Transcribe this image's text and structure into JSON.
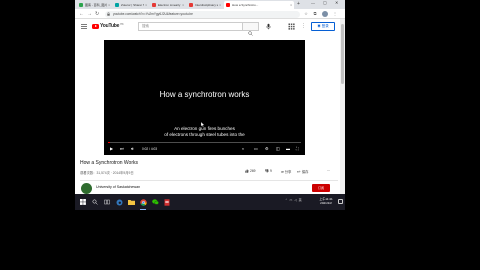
{
  "browser": {
    "tabs": [
      {
        "label": "图客 - 百科_图片...",
        "color": "#2da44e",
        "active": false
      },
      {
        "label": "Zoteror | Sharer N...",
        "color": "#00a3a3",
        "active": false
      },
      {
        "label": "Electron Linearly ...",
        "color": "#e53935",
        "active": false
      },
      {
        "label": "Interdisciplinary s...",
        "color": "#e53935",
        "active": false
      },
      {
        "label": "How a Synchrotro...",
        "color": "#ff0000",
        "active": true
      }
    ],
    "new_tab": "+",
    "url": "youtube.com/watch?v=Yu2mYgy6J2U&feature=youtu.be"
  },
  "youtube": {
    "logo_word": "YouTube",
    "region": "HK",
    "search_placeholder": "搜索",
    "sign_in": "登录"
  },
  "player": {
    "title": "How a synchrotron works",
    "caption_line1": "An electron gun fires bunches",
    "caption_line2": "of electrons through steel tubes into the",
    "time": "0:02 / 4:03",
    "progress": 0.008
  },
  "video": {
    "title": "How a Synchrotron Works",
    "views_date": "观看次数：31,574次 · 2014年9月9日",
    "likes": "269",
    "dislikes": "9",
    "share": "分享",
    "save": "保存",
    "channel": "University of Saskatchewan",
    "subscribe": "订阅"
  },
  "taskbar": {
    "clock_time": "上午11:41",
    "clock_date": "2021/1/2",
    "ime": "英",
    "colors": {
      "chrome": "#4285f4",
      "accent": "#8ab4f8"
    }
  }
}
